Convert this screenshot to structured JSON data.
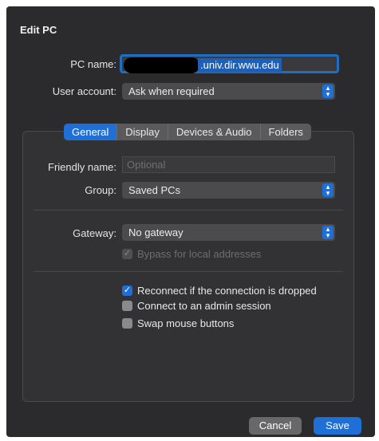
{
  "window": {
    "title": "Edit PC"
  },
  "form": {
    "pc_name_label": "PC name:",
    "pc_name_value": ".univ.dir.wwu.edu",
    "user_account_label": "User account:",
    "user_account_value": "Ask when required"
  },
  "tabs": [
    {
      "label": "General",
      "active": true
    },
    {
      "label": "Display"
    },
    {
      "label": "Devices & Audio"
    },
    {
      "label": "Folders"
    }
  ],
  "general": {
    "friendly_name_label": "Friendly name:",
    "friendly_name_placeholder": "Optional",
    "group_label": "Group:",
    "group_value": "Saved PCs",
    "gateway_label": "Gateway:",
    "gateway_value": "No gateway",
    "bypass_label": "Bypass for local addresses",
    "reconnect_label": "Reconnect if the connection is dropped",
    "admin_label": "Connect to an admin session",
    "swap_label": "Swap mouse buttons"
  },
  "buttons": {
    "cancel": "Cancel",
    "save": "Save"
  },
  "colors": {
    "accent": "#1e6fd6",
    "background": "#2b2b2d"
  }
}
